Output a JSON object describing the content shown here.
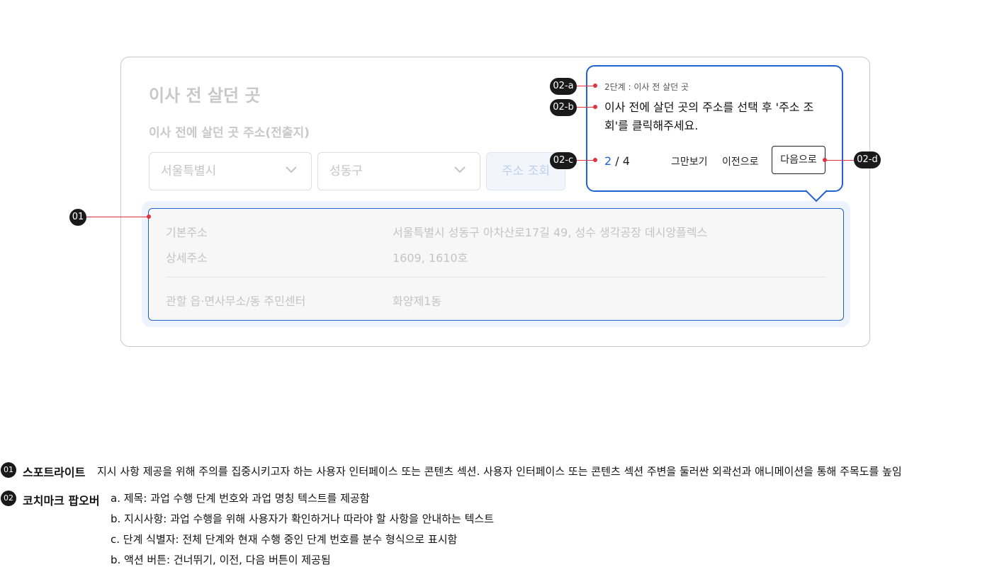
{
  "card": {
    "title": "이사 전 살던 곳",
    "subtitle": "이사 전에 살던 곳 주소(전출지)",
    "city_select": "서울특별시",
    "district_select": "성동구",
    "lookup_button": "주소 조회"
  },
  "spotlight": {
    "rows": [
      {
        "label": "기본주소",
        "value": "서울특별시 성동구 아차산로17길 49, 성수 생각공장 데시앙플렉스"
      },
      {
        "label": "상세주소",
        "value": "1609, 1610호"
      },
      {
        "label": "관할 읍·면사무소/동 주민센터",
        "value": "화양제1동"
      }
    ]
  },
  "popover": {
    "step_title": "2단계 : 이사 전 살던 곳",
    "instruction": "이사 전에 살던 곳의 주소를 선택 후 '주소 조회'를 클릭해주세요.",
    "current_step": "2",
    "separator": " / ",
    "total_steps": "4",
    "skip_button": "그만보기",
    "prev_button": "이전으로",
    "next_button": "다음으로"
  },
  "callouts": {
    "c01": "01",
    "c02a": "02-a",
    "c02b": "02-b",
    "c02c": "02-c",
    "c02d": "02-d"
  },
  "notes": {
    "n01_badge": "01",
    "n01_title": "스포트라이트",
    "n01_text": "지시 사항 제공을 위해 주의를 집중시키고자 하는 사용자 인터페이스 또는 콘텐츠 섹션. 사용자 인터페이스 또는 콘텐츠 섹션 주변을 둘러싼 외곽선과 애니메이션을 통해 주목도를 높임",
    "n02_badge": "02",
    "n02_title": "코치마크 팝오버",
    "n02_items": [
      "a. 제목: 과업 수행 단계 번호와 과업 명칭 텍스트를 제공함",
      "b. 지시사항:  과업 수행을 위해 사용자가 확인하거나 따라야 할 사항을 안내하는 텍스트",
      "c. 단계 식별자: 전체 단계와 현재 수행 중인 단계 번호를 분수 형식으로 표시함",
      "b. 액션 버튼: 건너뛰기, 이전, 다음 버튼이 제공됨"
    ]
  },
  "colors": {
    "accent": "#1f62d2",
    "callout_line": "#e2323f",
    "badge_bg": "#1a1a1a"
  }
}
